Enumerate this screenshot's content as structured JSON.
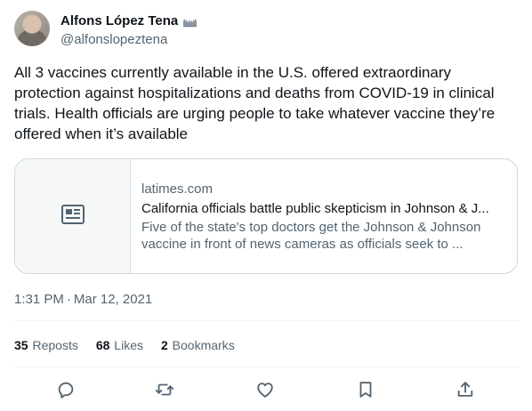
{
  "author": {
    "display_name": "Alfons López Tena",
    "handle": "@alfonslopeztena",
    "avatar_icon": "profile-photo",
    "name_badge_icon": "flag-icon"
  },
  "tweet": {
    "text": "All 3 vaccines currently available in the U.S. offered extraordinary protection against hospitalizations and deaths from COVID-19 in clinical trials. Health officials are urging people to take whatever vaccine they’re offered when it’s available"
  },
  "link_card": {
    "thumbnail_icon": "newspaper-icon",
    "domain": "latimes.com",
    "title": "California officials battle public skepticism in Johnson & J...",
    "description": "Five of the state's top doctors get the Johnson & Johnson vaccine in front of news cameras as officials seek to ..."
  },
  "meta": {
    "time": "1:31 PM",
    "separator": "·",
    "date": "Mar 12, 2021"
  },
  "stats": {
    "reposts_count": "35",
    "reposts_label": "Reposts",
    "likes_count": "68",
    "likes_label": "Likes",
    "bookmarks_count": "2",
    "bookmarks_label": "Bookmarks"
  },
  "actions": {
    "icons": [
      "reply-icon",
      "repost-icon",
      "like-icon",
      "bookmark-icon",
      "share-icon"
    ]
  },
  "colors": {
    "text_primary": "#0f1419",
    "text_secondary": "#536471",
    "border": "#cfd9de",
    "divider": "#eff3f4",
    "thumb_bg": "#f7f9f9"
  }
}
